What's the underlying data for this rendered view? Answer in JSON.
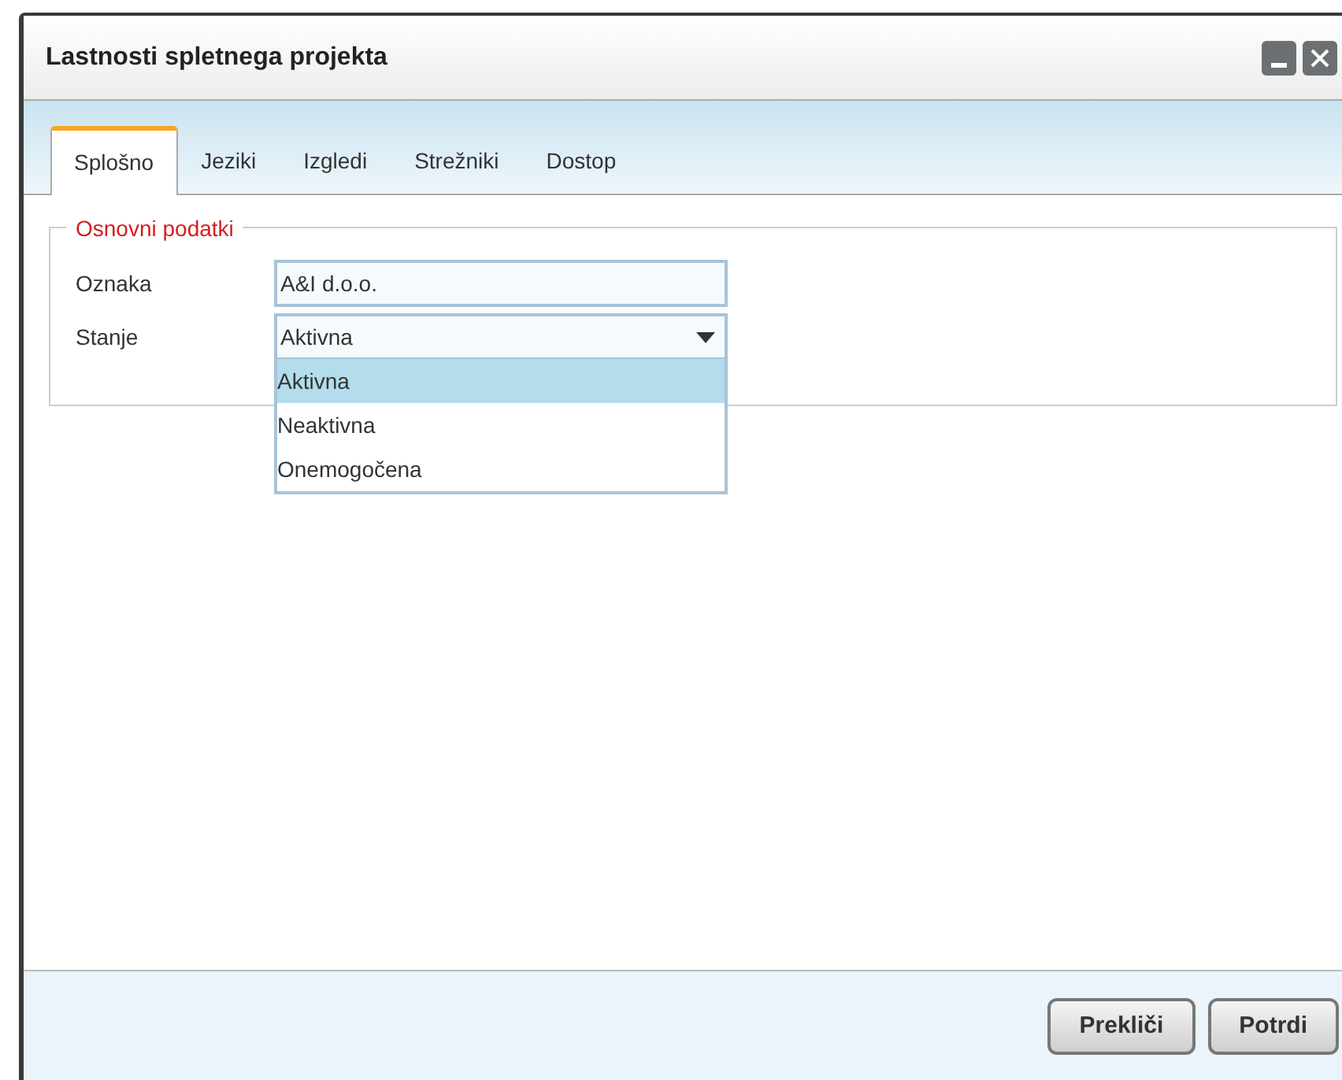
{
  "window": {
    "title": "Lastnosti spletnega projekta"
  },
  "tabs": [
    {
      "label": "Splošno",
      "selected": true
    },
    {
      "label": "Jeziki",
      "selected": false
    },
    {
      "label": "Izgledi",
      "selected": false
    },
    {
      "label": "Strežniki",
      "selected": false
    },
    {
      "label": "Dostop",
      "selected": false
    }
  ],
  "fieldset": {
    "legend": "Osnovni podatki",
    "fields": [
      {
        "kind": "text",
        "label": "Oznaka",
        "value": "A&I d.o.o."
      },
      {
        "kind": "select",
        "label": "Stanje",
        "value": "Aktivna",
        "expanded": true,
        "options": [
          {
            "label": "Aktivna",
            "selected": true
          },
          {
            "label": "Neaktivna",
            "selected": false
          },
          {
            "label": "Onemogočena",
            "selected": false
          }
        ]
      }
    ]
  },
  "buttons": [
    "Prekliči",
    "Potrdi"
  ]
}
